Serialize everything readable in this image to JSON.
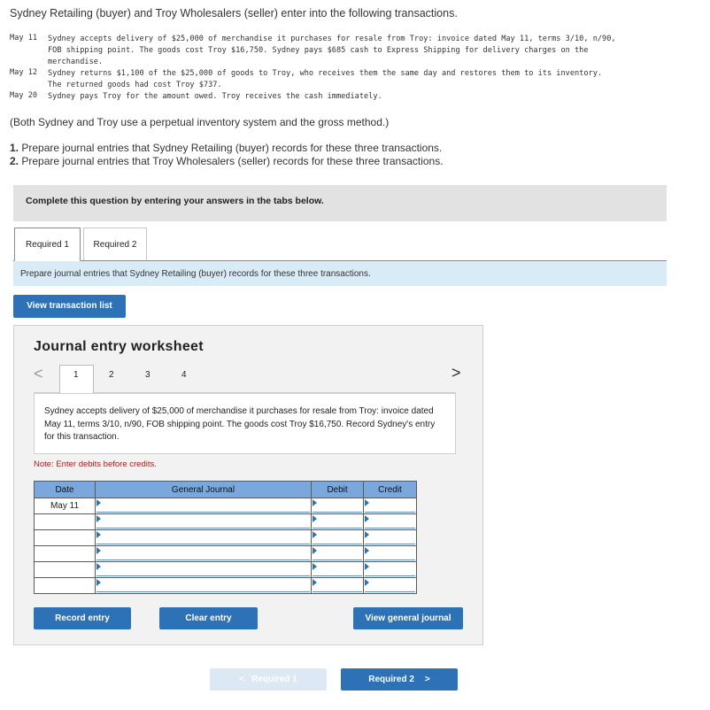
{
  "problem": {
    "intro": "Sydney Retailing (buyer) and Troy Wholesalers (seller) enter into the following transactions.",
    "transactions": [
      {
        "date": "May 11",
        "lines": [
          "Sydney accepts delivery of $25,000 of merchandise it purchases for resale from Troy: invoice dated May 11, terms 3/10, n/90,",
          "FOB shipping point. The goods cost Troy $16,750. Sydney pays $685 cash to Express Shipping for delivery charges on the",
          "merchandise."
        ]
      },
      {
        "date": "May 12",
        "lines": [
          "Sydney returns $1,100 of the $25,000 of goods to Troy, who receives them the same day and restores them to its inventory.",
          "The returned goods had cost Troy $737."
        ]
      },
      {
        "date": "May 20",
        "lines": [
          "Sydney pays Troy for the amount owed. Troy receives the cash immediately."
        ]
      }
    ],
    "system_note": "(Both Sydney and Troy use a perpetual inventory system and the gross method.)",
    "requirements": [
      {
        "num": "1.",
        "text": "Prepare journal entries that Sydney Retailing (buyer) records for these three transactions."
      },
      {
        "num": "2.",
        "text": "Prepare journal entries that Troy Wholesalers (seller) records for these three transactions."
      }
    ]
  },
  "banner": "Complete this question by entering your answers in the tabs below.",
  "tabs": [
    {
      "label": "Required 1",
      "active": true
    },
    {
      "label": "Required 2",
      "active": false
    }
  ],
  "instruction": "Prepare journal entries that Sydney Retailing (buyer) records for these three transactions.",
  "view_transaction_list": "View transaction list",
  "worksheet": {
    "title": "Journal entry worksheet",
    "prev_arrow": "<",
    "next_arrow": ">",
    "pages": [
      "1",
      "2",
      "3",
      "4"
    ],
    "active_page": "1",
    "description": "Sydney accepts delivery of $25,000 of merchandise it purchases for resale from Troy: invoice dated May 11, terms 3/10, n/90, FOB shipping point. The goods cost Troy $16,750. Record Sydney's entry for this transaction.",
    "note": "Note: Enter debits before credits.",
    "columns": [
      "Date",
      "General Journal",
      "Debit",
      "Credit"
    ],
    "rows": [
      {
        "date": "May 11",
        "account": "",
        "debit": "",
        "credit": ""
      },
      {
        "date": "",
        "account": "",
        "debit": "",
        "credit": ""
      },
      {
        "date": "",
        "account": "",
        "debit": "",
        "credit": ""
      },
      {
        "date": "",
        "account": "",
        "debit": "",
        "credit": ""
      },
      {
        "date": "",
        "account": "",
        "debit": "",
        "credit": ""
      },
      {
        "date": "",
        "account": "",
        "debit": "",
        "credit": ""
      }
    ],
    "record_entry": "Record entry",
    "clear_entry": "Clear entry",
    "view_general_journal": "View general journal"
  },
  "footer_nav": {
    "prev_label": "Required 1",
    "prev_arrow": "<",
    "next_label": "Required 2",
    "next_arrow": ">"
  },
  "colors": {
    "accent": "#2d72b7",
    "header_blue": "#7aa8dc",
    "note_red": "#a02020",
    "instr_bg": "#d9ebf7"
  }
}
